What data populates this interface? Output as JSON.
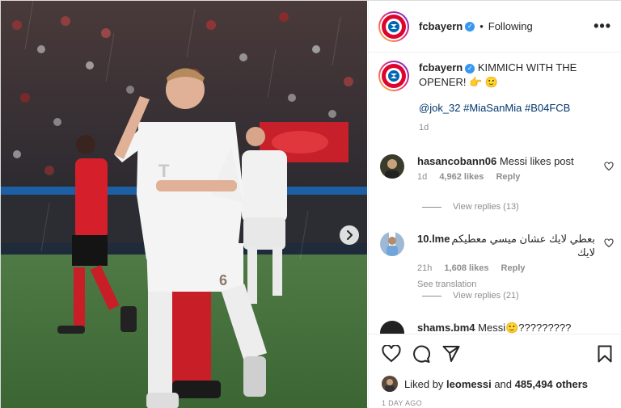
{
  "post": {
    "username": "fcbayern",
    "separator": "•",
    "follow_status": "Following",
    "more_label": "•••"
  },
  "caption": {
    "username": "fcbayern",
    "text": "KIMMICH WITH THE OPENER! 👉 🙂",
    "tags": "@jok_32 #MiaSanMia #B04FCB",
    "time": "1d"
  },
  "comments": [
    {
      "username": "hasancobann06",
      "text": "Messi likes post",
      "time": "1d",
      "likes": "4,962 likes",
      "reply": "Reply",
      "view_replies": "View replies (13)"
    },
    {
      "username": "10.lme",
      "text": "بعطي لايك عشان ميسي معطيكم لايك",
      "time": "21h",
      "likes": "1,608 likes",
      "reply": "Reply",
      "see_translation": "See translation",
      "view_replies": "View replies (21)"
    },
    {
      "username": "shams.bm4",
      "text": "Messi🙂?????????"
    }
  ],
  "liked_by": {
    "prefix": "Liked by",
    "user": "leomessi",
    "connector": "and",
    "others": "485,494 others"
  },
  "date": "1 DAY AGO",
  "colors": {
    "bayern_red": "#dc052d",
    "link_blue": "#00376b",
    "verified_blue": "#3897f0",
    "muted": "#8e8e8e"
  },
  "icons": [
    "verified-badge-icon",
    "more-icon",
    "heart-icon",
    "comment-icon",
    "share-icon",
    "bookmark-icon",
    "next-arrow-icon"
  ]
}
